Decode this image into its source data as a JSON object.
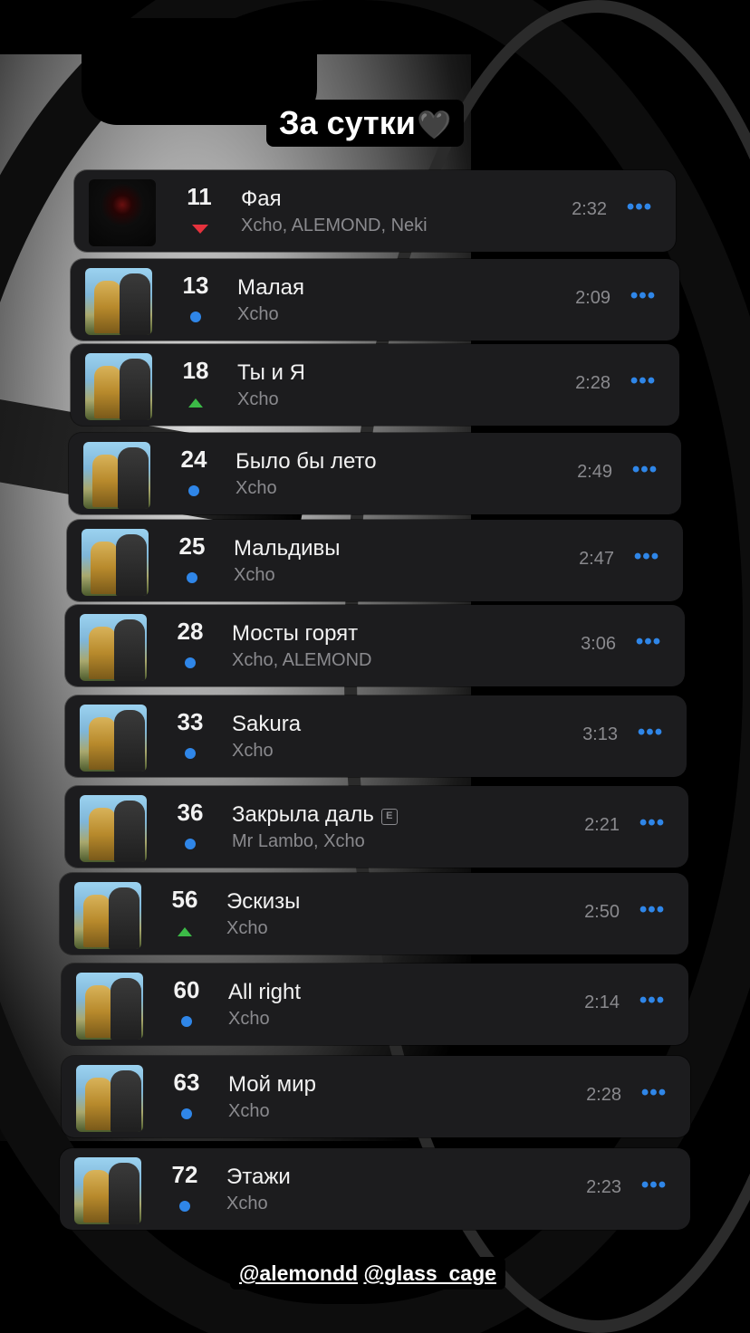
{
  "story": {
    "title": "За сутки",
    "title_emoji": "🖤",
    "mentions": [
      "@alemondd",
      "@glass_cage"
    ]
  },
  "colors": {
    "card_bg": "#1c1c1e",
    "accent_blue": "#2f86e8",
    "trend_up": "#3cba47",
    "trend_down": "#e5323d",
    "secondary_text": "#8a8a8e"
  },
  "tracks": [
    {
      "rank": "11",
      "trend": "down",
      "title": "Фая",
      "artist": "Xcho, ALEMOND, Neki",
      "duration": "2:32",
      "explicit": false,
      "art": "dark"
    },
    {
      "rank": "13",
      "trend": "same",
      "title": "Малая",
      "artist": "Xcho",
      "duration": "2:09",
      "explicit": false,
      "art": "photo"
    },
    {
      "rank": "18",
      "trend": "up",
      "title": "Ты и Я",
      "artist": "Xcho",
      "duration": "2:28",
      "explicit": false,
      "art": "photo"
    },
    {
      "rank": "24",
      "trend": "same",
      "title": "Было бы лето",
      "artist": "Xcho",
      "duration": "2:49",
      "explicit": false,
      "art": "photo"
    },
    {
      "rank": "25",
      "trend": "same",
      "title": "Мальдивы",
      "artist": "Xcho",
      "duration": "2:47",
      "explicit": false,
      "art": "photo"
    },
    {
      "rank": "28",
      "trend": "same",
      "title": "Мосты горят",
      "artist": "Xcho, ALEMOND",
      "duration": "3:06",
      "explicit": false,
      "art": "photo"
    },
    {
      "rank": "33",
      "trend": "same",
      "title": "Sakura",
      "artist": "Xcho",
      "duration": "3:13",
      "explicit": false,
      "art": "photo"
    },
    {
      "rank": "36",
      "trend": "same",
      "title": "Закрыла даль",
      "artist": "Mr Lambo, Xcho",
      "duration": "2:21",
      "explicit": true,
      "explicit_label": "E",
      "art": "photo"
    },
    {
      "rank": "56",
      "trend": "up",
      "title": "Эскизы",
      "artist": "Xcho",
      "duration": "2:50",
      "explicit": false,
      "art": "photo"
    },
    {
      "rank": "60",
      "trend": "same",
      "title": "All right",
      "artist": "Xcho",
      "duration": "2:14",
      "explicit": false,
      "art": "photo"
    },
    {
      "rank": "63",
      "trend": "same",
      "title": "Мой мир",
      "artist": "Xcho",
      "duration": "2:28",
      "explicit": false,
      "art": "photo"
    },
    {
      "rank": "72",
      "trend": "same",
      "title": "Этажи",
      "artist": "Xcho",
      "duration": "2:23",
      "explicit": false,
      "art": "photo"
    }
  ],
  "more_label": "•••"
}
